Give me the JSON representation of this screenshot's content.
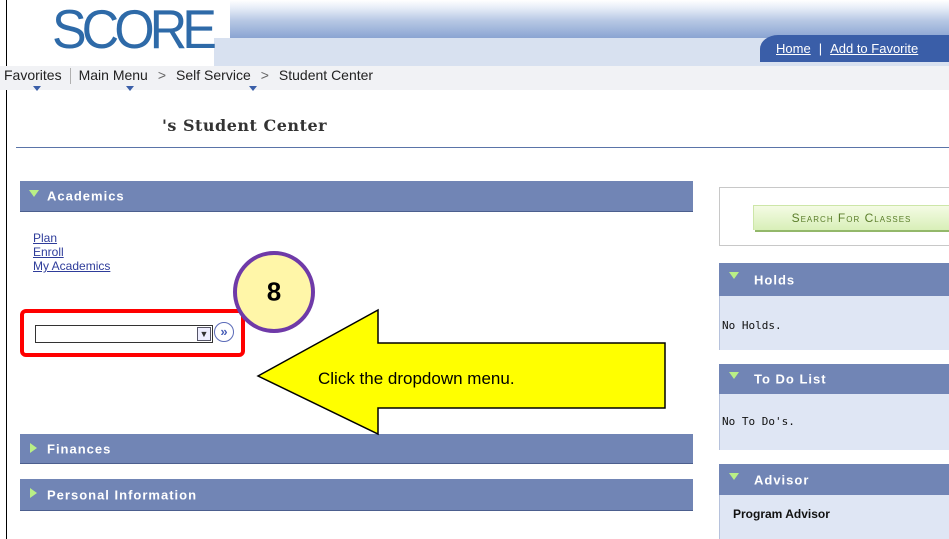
{
  "header": {
    "logo_text": "SCORE",
    "links": {
      "home": "Home",
      "favorites": "Add to Favorite"
    },
    "link_separator": "|"
  },
  "nav": {
    "favorites": "Favorites",
    "main_menu": "Main Menu",
    "self_service": "Self Service",
    "student_center": "Student Center",
    "chevron": ">"
  },
  "page": {
    "title": "'s Student Center"
  },
  "academics": {
    "header": "Academics",
    "links": [
      "Plan",
      "Enroll",
      "My Academics"
    ],
    "dropdown_value": "",
    "go_glyph": "»"
  },
  "finances": {
    "header": "Finances"
  },
  "personal_info": {
    "header": "Personal Information"
  },
  "search": {
    "button_label": "Search For Classes"
  },
  "holds": {
    "header": "Holds",
    "text": "No Holds."
  },
  "todo": {
    "header": "To Do List",
    "text": "No To Do's."
  },
  "advisor": {
    "header": "Advisor",
    "text": "Program Advisor"
  },
  "annotation": {
    "step_number": "8",
    "instruction": "Click the dropdown menu.",
    "colors": {
      "highlight": "#ff0000",
      "circle_border": "#6f3aa8",
      "fill": "#fff6a8",
      "arrow": "#ffff00"
    }
  }
}
